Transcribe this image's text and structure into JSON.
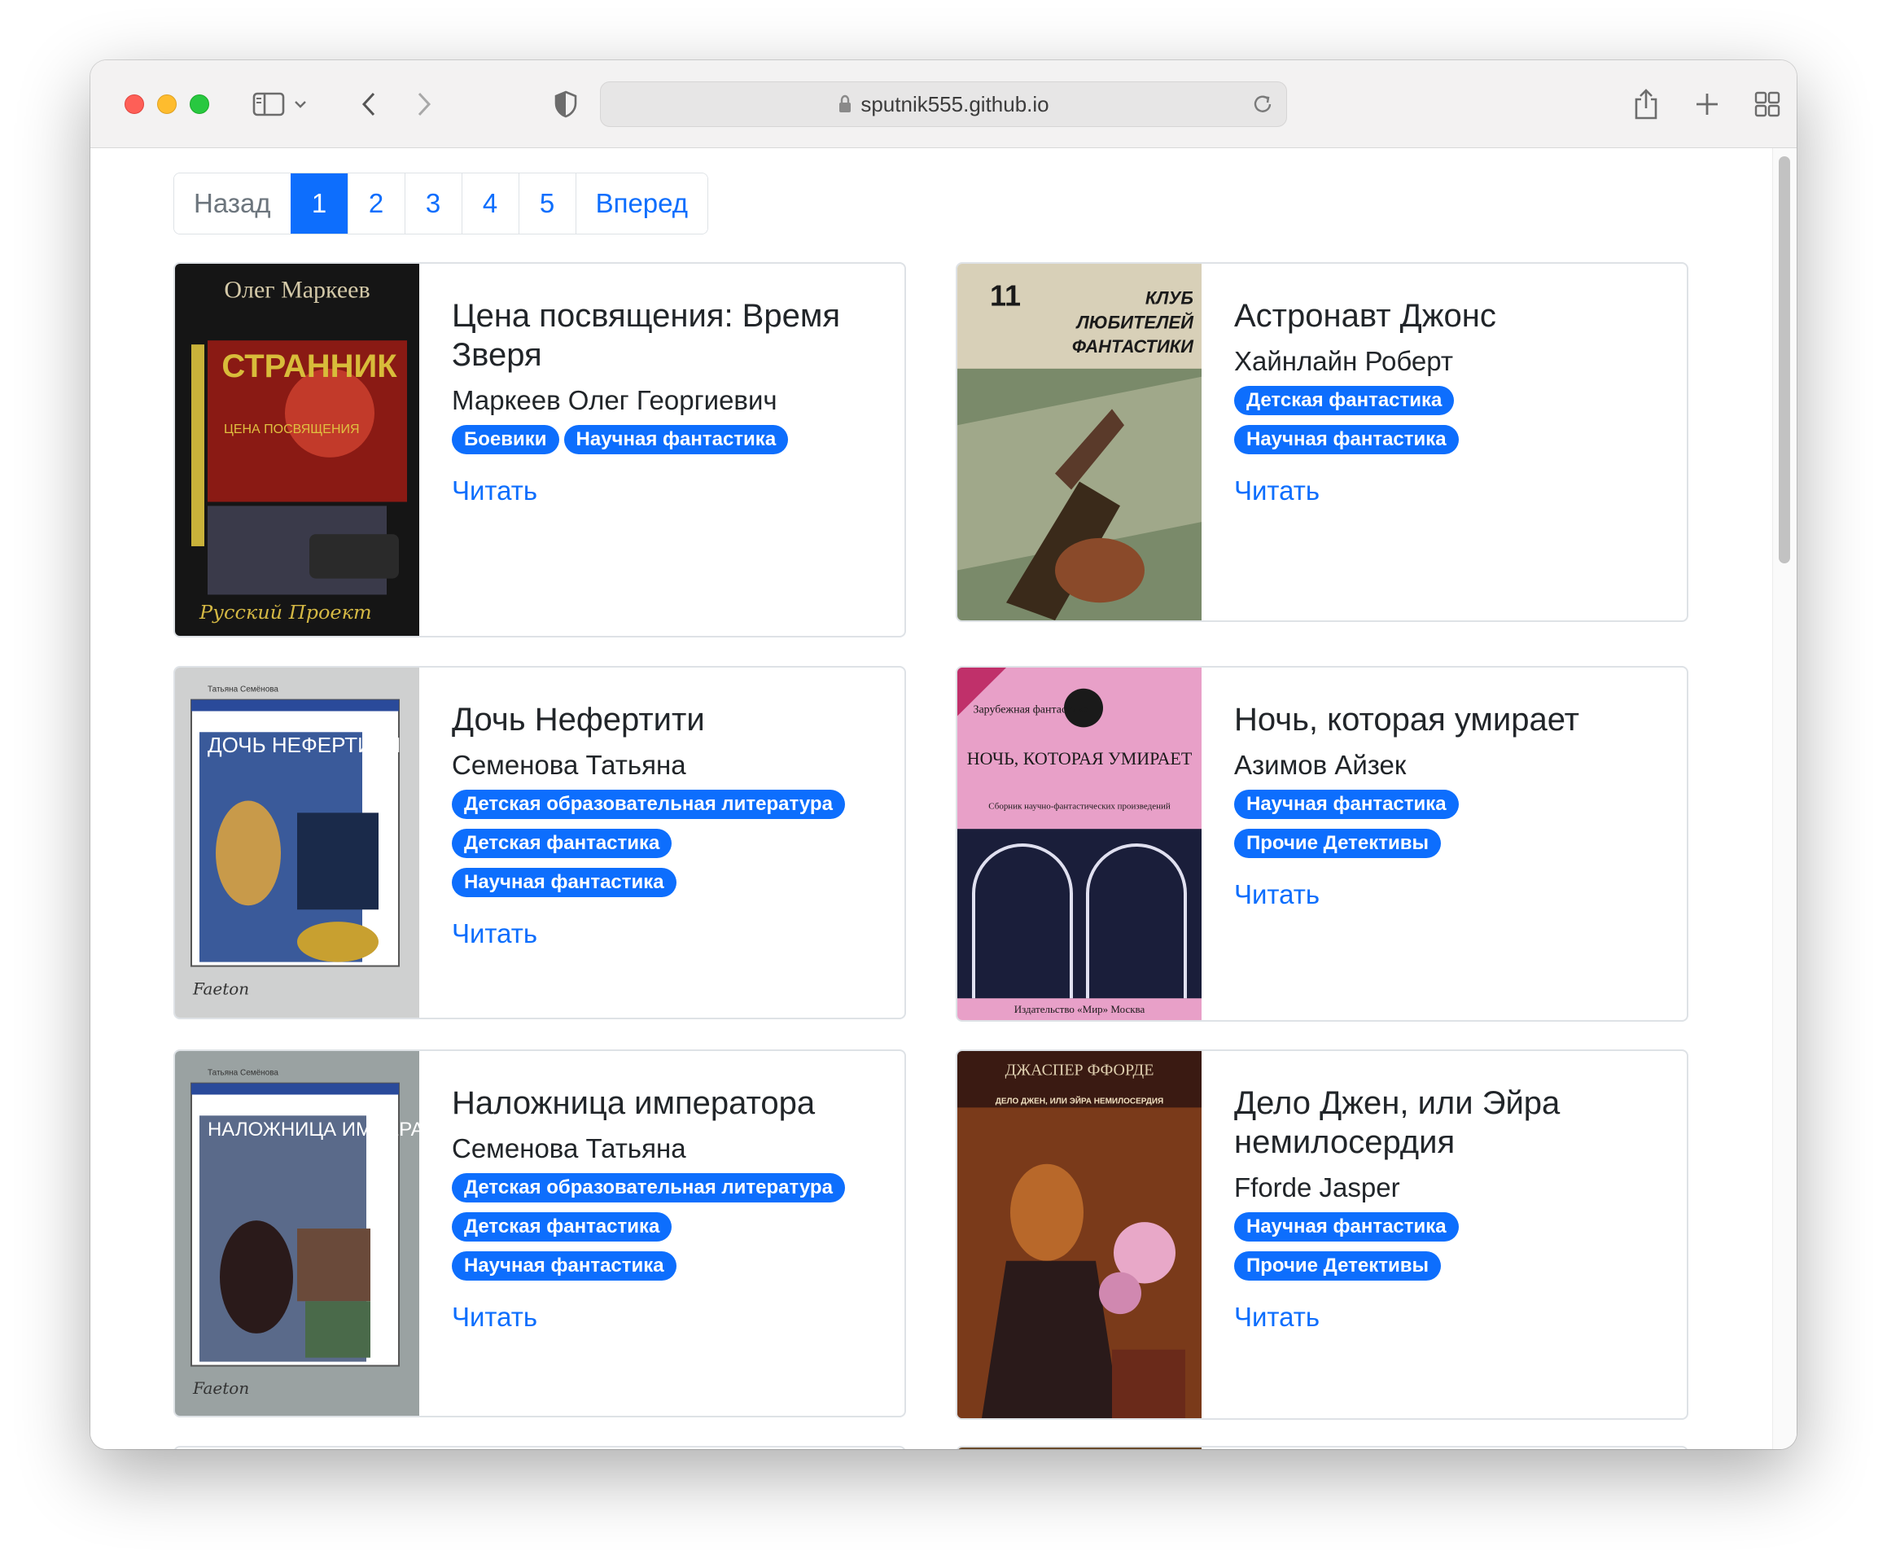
{
  "browser": {
    "url": "sputnik555.github.io"
  },
  "pagination": {
    "prev": "Назад",
    "pages": [
      "1",
      "2",
      "3",
      "4",
      "5"
    ],
    "active": "1",
    "next": "Вперед"
  },
  "books": [
    {
      "title": "Цена посвящения: Время Зверя",
      "author": "Маркеев Олег Георгиевич",
      "genres": [
        "Боевики",
        "Научная фантастика"
      ],
      "read": "Читать",
      "cover": {
        "top_text": "Олег Маркеев",
        "main_text": "СТРАННИК",
        "sub_text": "ЦЕНА ПОСВЯЩЕНИЯ",
        "bottom_text": "Русский Проект",
        "colors": [
          "#1a1a1a",
          "#b8231c",
          "#d4b844"
        ]
      }
    },
    {
      "title": "Астронавт Джонс",
      "author": "Хайнлайн Роберт",
      "genres": [
        "Детская фантастика",
        "Научная фантастика"
      ],
      "read": "Читать",
      "cover": {
        "top_text": "11",
        "main_text": "КЛУБ ЛЮБИТЕЛЕЙ ФАНТАСТИКИ",
        "colors": [
          "#d8d0b8",
          "#6b7a5a",
          "#8a5a3a"
        ]
      }
    },
    {
      "title": "Дочь Нефертити",
      "author": "Семенова Татьяна",
      "genres": [
        "Детская образовательная литература",
        "Детская фантастика",
        "Научная фантастика"
      ],
      "read": "Читать",
      "cover": {
        "top_text": "Татьяна Семёнова",
        "main_text": "ДОЧЬ НЕФЕРТИТИ",
        "bottom_text": "Faeton",
        "colors": [
          "#cfd0d0",
          "#3a5a9a",
          "#c89a4a"
        ]
      }
    },
    {
      "title": "Ночь, которая умирает",
      "author": "Азимов Айзек",
      "genres": [
        "Научная фантастика",
        "Прочие Детективы"
      ],
      "read": "Читать",
      "cover": {
        "top_text": "Зарубежная фантастика",
        "main_text": "НОЧЬ, КОТОРАЯ УМИРАЕТ",
        "sub_text": "Сборник научно-фантастических произведений",
        "bottom_text": "Издательство «Мир» Москва",
        "colors": [
          "#e8a0c8",
          "#1a1e3a",
          "#f0c0dc"
        ]
      }
    },
    {
      "title": "Наложница императора",
      "author": "Семенова Татьяна",
      "genres": [
        "Детская образовательная литература",
        "Детская фантастика",
        "Научная фантастика"
      ],
      "read": "Читать",
      "cover": {
        "top_text": "Татьяна Семёнова",
        "main_text": "НАЛОЖНИЦА ИМПЕРАТОРА",
        "bottom_text": "Faeton",
        "colors": [
          "#9aa2a2",
          "#2a4a8a",
          "#6a4a3a"
        ]
      }
    },
    {
      "title": "Дело Джен, или Эйра немилосердия",
      "author": "Fforde Jasper",
      "genres": [
        "Научная фантастика",
        "Прочие Детективы"
      ],
      "read": "Читать",
      "cover": {
        "top_text": "ДЖАСПЕР ФФОРДЕ",
        "main_text": "ДЕЛО ДЖЕН, ИЛИ ЭЙРА НЕМИЛОСЕРДИЯ",
        "colors": [
          "#3a1a12",
          "#b8682a",
          "#e8a8c8"
        ]
      }
    }
  ]
}
